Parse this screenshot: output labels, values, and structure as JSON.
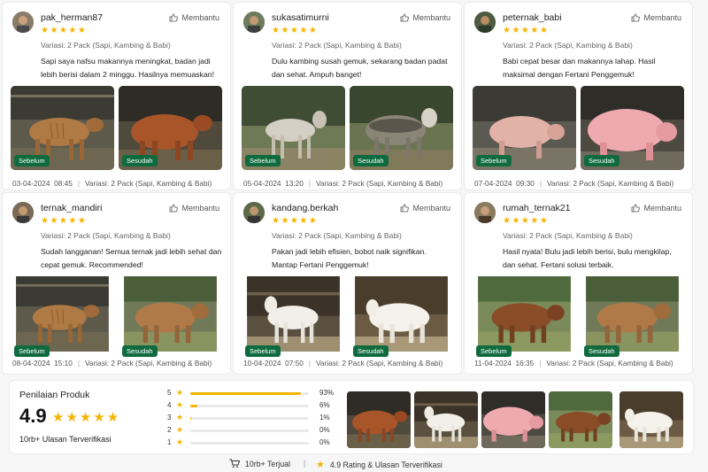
{
  "helpful_label": "Membantu",
  "reviews": [
    {
      "user": "pak_herman87",
      "stars": "★★★★★",
      "variant": "Variasi: 2 Pack (Sapi, Kambing & Babi)",
      "text": "Sapi saya nafsu makannya meningkat, badan jadi lebih berisi dalam 2 minggu. Hasilnya memuaskan!",
      "before": "Sebelum",
      "after": "Sesudah",
      "date": "03-04-2024",
      "time": "08:45",
      "meta_variant": "Variasi: 2 Pack (Sapi, Kambing & Babi)"
    },
    {
      "user": "sukasatimurni",
      "stars": "★★★★★",
      "variant": "Variasi: 2 Pack (Sapi, Kambing & Babi)",
      "text": "Dulu kambing susah gemuk, sekarang badan padat dan sehat. Ampuh banget!",
      "before": "Sebelum",
      "after": "Sesudah",
      "date": "05-04-2024",
      "time": "13:20",
      "meta_variant": "Variasi: 2 Pack (Sapi, Kambing & Babi)"
    },
    {
      "user": "peternak_babi",
      "stars": "★★★★★",
      "variant": "Variasi: 2 Pack (Sapi, Kambing & Babi)",
      "text": "Babi cepat besar dan makannya lahap. Hasil maksimal dengan Fertani Penggemuk!",
      "before": "Sebelum",
      "after": "Sesudah",
      "date": "07-04-2024",
      "time": "09:30",
      "meta_variant": "Variasi: 2 Pack (Sapi, Kambing & Babi)"
    },
    {
      "user": "ternak_mandiri",
      "stars": "★★★★★",
      "variant": "Variasi: 2 Pack (Sapi, Kambing & Babi)",
      "text": "Sudah langganan! Semua ternak jadi lebih sehat dan cepat gemuk. Recommended!",
      "before": "Sebelum",
      "after": "Sesudah",
      "date": "08-04-2024",
      "time": "15:10",
      "meta_variant": "Variasi: 2 Pack (Sapi, Kambing & Babi)"
    },
    {
      "user": "kandang.berkah",
      "stars": "★★★★★",
      "variant": "Variasi: 2 Pack (Sapi, Kambing & Babi)",
      "text": "Pakan jadi lebih efisien, bobot naik signifikan. Mantap Fertani Penggemuk!",
      "before": "Sebelum",
      "after": "Sesudah",
      "date": "10-04-2024",
      "time": "07:50",
      "meta_variant": "Variasi: 2 Pack (Sapi, Kambing & Babi)"
    },
    {
      "user": "rumah_ternak21",
      "stars": "★★★★★",
      "variant": "Variasi: 2 Pack (Sapi, Kambing & Babi)",
      "text": "Hasil nyata! Bulu jadi lebih berisi, bulu mengkilap, dan sehat. Fertani solusi terbaik.",
      "before": "Sebelum",
      "after": "Sesudah",
      "date": "11-04-2024",
      "time": "16:35",
      "meta_variant": "Variasi: 2 Pack (Sapi, Kambing & Babi)"
    }
  ],
  "summary": {
    "title": "Penilaian Produk",
    "score": "4.9",
    "stars": "★★★★★",
    "count": "10rb+ Ulasan Terverifikasi",
    "distribution": [
      {
        "label": "5",
        "pct": "93%",
        "fraction": 0.93
      },
      {
        "label": "4",
        "pct": "6%",
        "fraction": 0.06
      },
      {
        "label": "3",
        "pct": "1%",
        "fraction": 0.01
      },
      {
        "label": "2",
        "pct": "0%",
        "fraction": 0
      },
      {
        "label": "1",
        "pct": "0%",
        "fraction": 0
      }
    ]
  },
  "footer": {
    "sold": "10rb+ Terjual",
    "rating": "4.9 Rating & Ulasan Terverifikasi"
  },
  "colors": {
    "star": "#f5b400",
    "tag": "#0f6b3d",
    "bar_track": "#e9e9e9"
  }
}
